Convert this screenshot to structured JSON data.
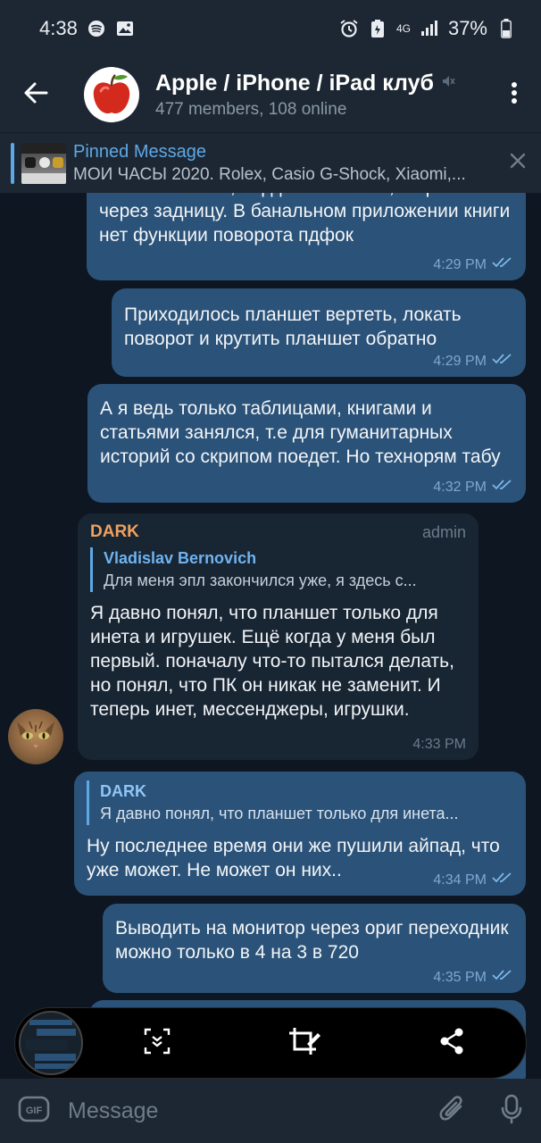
{
  "status_bar": {
    "time": "4:38",
    "network": "4G",
    "battery": "37%"
  },
  "header": {
    "title": "Apple / iPhone / iPad клуб",
    "subtitle": "477 members, 108 online"
  },
  "pinned": {
    "title": "Pinned Message",
    "text": "МОИ ЧАСЫ 2020. Rolex, Casio G-Shock, Xiaomi,..."
  },
  "messages": [
    {
      "text": "Это то заменит, ворд ексель есть, но работают через задницу. В банальном приложении книги нет функции поворота пдфок",
      "time": "4:29 PM"
    },
    {
      "text": "Приходилось планшет вертеть,  локать поворот и крутить планшет обратно",
      "time": "4:29 PM"
    },
    {
      "text": "А я ведь только таблицами, книгами и статьями занялся, т.е для гуманитарных историй со скрипом поедет. Но технорям табу",
      "time": "4:32 PM"
    },
    {
      "sender": "DARK",
      "badge": "admin",
      "reply_name": "Vladislav Bernovich",
      "reply_text": "Для меня эпл закончился уже, я здесь с...",
      "text": "Я давно понял, что планшет только для инета и игрушек. Ещё когда у меня был первый. поначалу что-то пытался делать, но понял, что ПК он никак не заменит. И теперь инет, мессенджеры, игрушки.",
      "time": "4:33 PM"
    },
    {
      "reply_name": "DARK",
      "reply_text": "Я давно понял, что планшет только для инета...",
      "text": "Ну последнее время они же пушили айпад, что уже может. Не может он них..",
      "time": "4:34 PM"
    },
    {
      "text": "Выводить на монитор через ориг переходник можно только в 4 на 3 в 720",
      "time": "4:35 PM"
    }
  ],
  "input": {
    "placeholder": "Message",
    "gif_label": "GIF"
  },
  "colors": {
    "background": "#0e1621",
    "header": "#1d2733",
    "outgoing_bubble": "#2b5278",
    "incoming_bubble": "#182533",
    "accent": "#5ea8e5",
    "sender_name": "#f0a15d"
  },
  "icons": {
    "back": "arrow-left-icon",
    "more": "more-vertical-icon",
    "mute": "muted-speaker-icon",
    "close": "close-icon",
    "read": "double-check-icon",
    "scroll_capture": "scroll-capture-icon",
    "crop_edit": "crop-edit-icon",
    "share": "share-icon",
    "gif": "gif-icon",
    "attach": "paperclip-icon",
    "mic": "microphone-icon"
  }
}
